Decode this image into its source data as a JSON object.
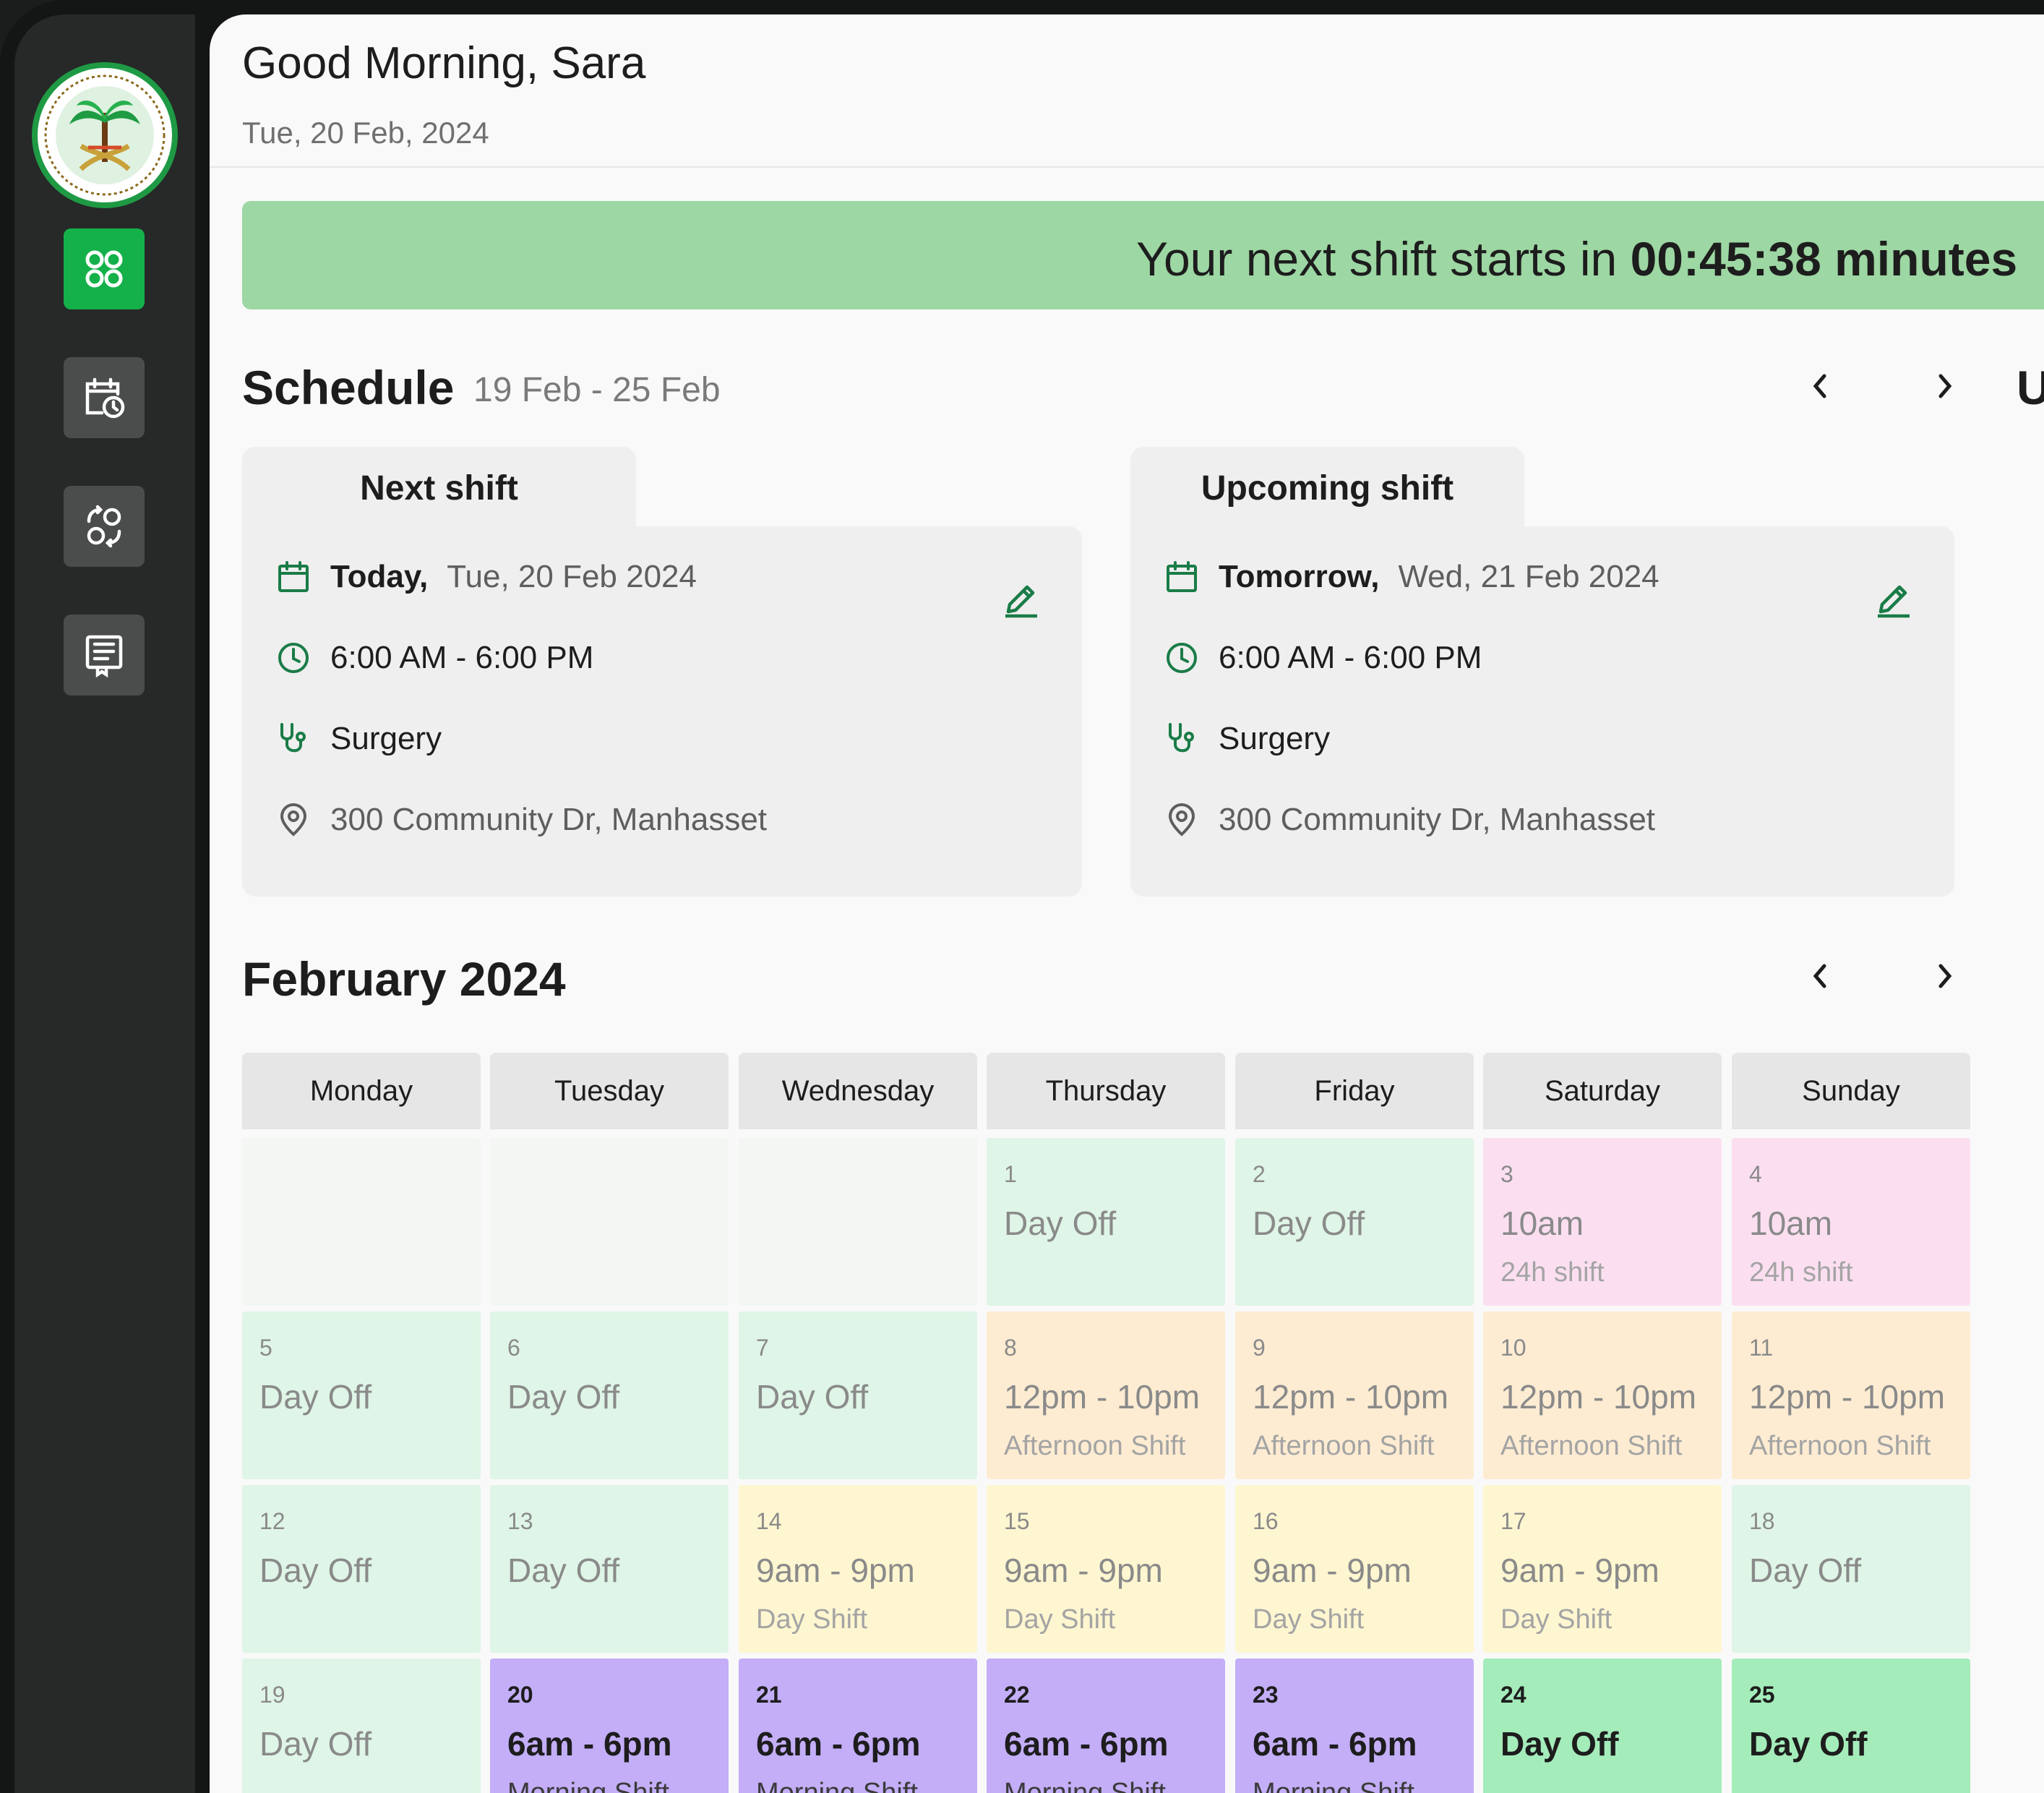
{
  "colors": {
    "accent": "#14b14a",
    "banner": "#9dd7a3",
    "icon_green": "#1a7c47"
  },
  "header": {
    "greeting": "Good Morning, Sara",
    "date": "Tue, 20 Feb, 2024"
  },
  "banner": {
    "prefix": "Your next shift starts in",
    "countdown": "00:45:38 minutes"
  },
  "nav": {
    "items": [
      "dashboard-icon",
      "calendar-clock-icon",
      "swap-icon",
      "reports-icon"
    ],
    "active": "dashboard-icon"
  },
  "schedule": {
    "title": "Schedule",
    "range": "19 Feb - 25 Feb",
    "side_heading_cut": "U",
    "next": {
      "tab": "Next shift",
      "day": "Today,",
      "date": "Tue, 20 Feb 2024",
      "time": "6:00 AM - 6:00 PM",
      "department": "Surgery",
      "address": "300 Community Dr, Manhasset"
    },
    "upcoming": {
      "tab": "Upcoming shift",
      "day": "Tomorrow,",
      "date": "Wed, 21 Feb 2024",
      "time": "6:00 AM - 6:00 PM",
      "department": "Surgery",
      "address": "300 Community Dr, Manhasset"
    }
  },
  "calendar": {
    "title": "February 2024",
    "days": [
      "Monday",
      "Tuesday",
      "Wednesday",
      "Thursday",
      "Friday",
      "Saturday",
      "Sunday"
    ],
    "weeks": [
      [
        {
          "day": "",
          "title": "",
          "subtitle": "",
          "kind": "empty"
        },
        {
          "day": "",
          "title": "",
          "subtitle": "",
          "kind": "empty"
        },
        {
          "day": "",
          "title": "",
          "subtitle": "",
          "kind": "empty"
        },
        {
          "day": "1",
          "title": "Day Off",
          "subtitle": "",
          "kind": "off"
        },
        {
          "day": "2",
          "title": "Day Off",
          "subtitle": "",
          "kind": "off"
        },
        {
          "day": "3",
          "title": "10am",
          "subtitle": "24h shift",
          "kind": "pink"
        },
        {
          "day": "4",
          "title": "10am",
          "subtitle": "24h shift",
          "kind": "pink"
        }
      ],
      [
        {
          "day": "5",
          "title": "Day Off",
          "subtitle": "",
          "kind": "off"
        },
        {
          "day": "6",
          "title": "Day Off",
          "subtitle": "",
          "kind": "off"
        },
        {
          "day": "7",
          "title": "Day Off",
          "subtitle": "",
          "kind": "off"
        },
        {
          "day": "8",
          "title": "12pm - 10pm",
          "subtitle": "Afternoon Shift",
          "kind": "orange"
        },
        {
          "day": "9",
          "title": "12pm - 10pm",
          "subtitle": "Afternoon Shift",
          "kind": "orange"
        },
        {
          "day": "10",
          "title": "12pm - 10pm",
          "subtitle": "Afternoon Shift",
          "kind": "orange"
        },
        {
          "day": "11",
          "title": "12pm - 10pm",
          "subtitle": "Afternoon Shift",
          "kind": "orange"
        }
      ],
      [
        {
          "day": "12",
          "title": "Day Off",
          "subtitle": "",
          "kind": "off"
        },
        {
          "day": "13",
          "title": "Day Off",
          "subtitle": "",
          "kind": "off"
        },
        {
          "day": "14",
          "title": "9am - 9pm",
          "subtitle": "Day Shift",
          "kind": "yellow"
        },
        {
          "day": "15",
          "title": "9am - 9pm",
          "subtitle": "Day Shift",
          "kind": "yellow"
        },
        {
          "day": "16",
          "title": "9am - 9pm",
          "subtitle": "Day Shift",
          "kind": "yellow"
        },
        {
          "day": "17",
          "title": "9am - 9pm",
          "subtitle": "Day Shift",
          "kind": "yellow"
        },
        {
          "day": "18",
          "title": "Day Off",
          "subtitle": "",
          "kind": "off"
        }
      ],
      [
        {
          "day": "19",
          "title": "Day Off",
          "subtitle": "",
          "kind": "off"
        },
        {
          "day": "20",
          "title": "6am - 6pm",
          "subtitle": "Morning Shift",
          "kind": "purple"
        },
        {
          "day": "21",
          "title": "6am - 6pm",
          "subtitle": "Morning Shift",
          "kind": "purple"
        },
        {
          "day": "22",
          "title": "6am - 6pm",
          "subtitle": "Morning Shift",
          "kind": "purple"
        },
        {
          "day": "23",
          "title": "6am - 6pm",
          "subtitle": "Morning Shift",
          "kind": "purple"
        },
        {
          "day": "24",
          "title": "Day Off",
          "subtitle": "",
          "kind": "green"
        },
        {
          "day": "25",
          "title": "Day Off",
          "subtitle": "",
          "kind": "green"
        }
      ]
    ]
  }
}
